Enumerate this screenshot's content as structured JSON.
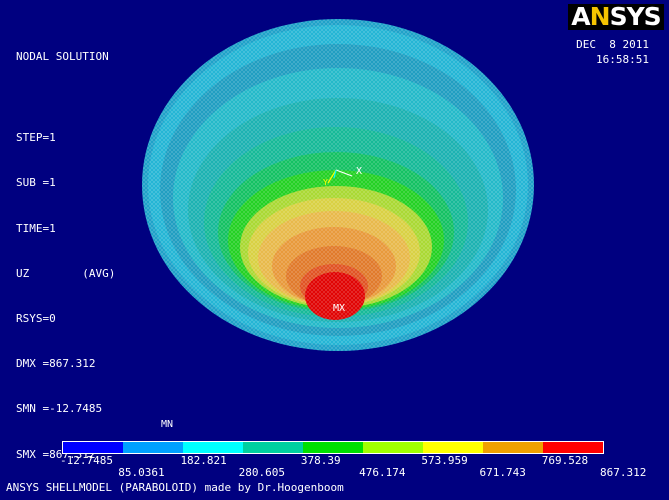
{
  "header": {
    "title": "NODAL SOLUTION",
    "lines": [
      "STEP=1",
      "SUB =1",
      "TIME=1",
      "UZ        (AVG)",
      "RSYS=0",
      "DMX =867.312",
      "SMN =-12.7485",
      "SMX =867.312"
    ]
  },
  "brand": {
    "logo": "ANSYS"
  },
  "datetime": {
    "date": "DEC  8 2011",
    "time": "16:58:51"
  },
  "plot_labels": {
    "axis_x": "X",
    "axis_y": "Y",
    "max_marker": "MX",
    "min_marker": "MN"
  },
  "legend": {
    "colors": [
      "#0000ff",
      "#00a0ff",
      "#00ffff",
      "#00d0a0",
      "#00e000",
      "#a0ff00",
      "#ffff00",
      "#f0a000",
      "#ff0000"
    ],
    "ticks_top": [
      "-12.7485",
      "182.821",
      "378.39",
      "573.959",
      "769.528"
    ],
    "ticks_bottom": [
      "85.0361",
      "280.605",
      "476.174",
      "671.743",
      "867.312"
    ]
  },
  "footer": {
    "caption": "ANSYS SHELLMODEL (PARABOLOID) made by Dr.Hoogenboom"
  }
}
